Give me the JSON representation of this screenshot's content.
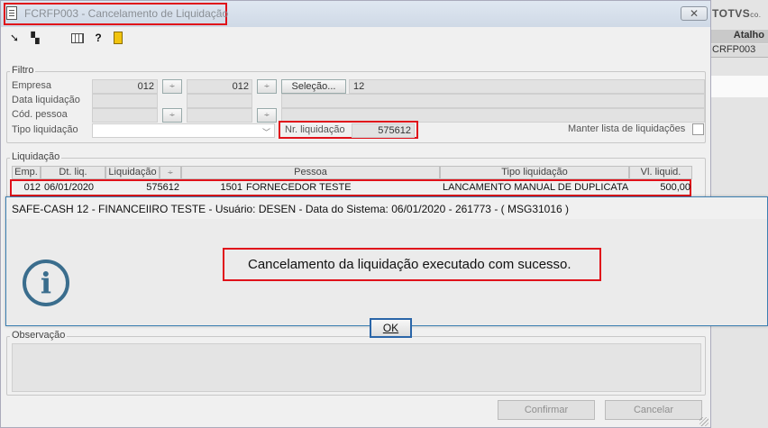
{
  "background": {
    "logo": "TOTVS",
    "logo_suffix": "co.",
    "header": "Atalho",
    "row": "CRFP003"
  },
  "window": {
    "title": "FCRFP003 - Cancelamento de Liquidação"
  },
  "filtro": {
    "title": "Filtro",
    "empresa_label": "Empresa",
    "empresa_from": "012",
    "empresa_to": "012",
    "selecao_label": "Seleção...",
    "selecao_value": "12",
    "data_label": "Data liquidação",
    "pessoa_label": "Cód. pessoa",
    "tipo_label": "Tipo liquidação",
    "nr_label": "Nr. liquidação",
    "nr_value": "575612",
    "manter_label": "Manter lista de liquidações"
  },
  "liquidacao": {
    "title": "Liquidação",
    "columns": [
      "Emp.",
      "Dt. liq.",
      "Liquidação",
      "",
      "Pessoa",
      "Tipo liquidação",
      "Vl. liquid."
    ],
    "row": {
      "emp": "012",
      "dt": "06/01/2020",
      "liq": "575612",
      "cod": "1501",
      "pessoa": "FORNECEDOR TESTE",
      "tipo": "LANCAMENTO MANUAL DE DUPLICATA",
      "valor": "500,00"
    }
  },
  "observacao": {
    "title": "Observação"
  },
  "footer": {
    "confirmar_label": "Confirmar",
    "cancelar_label": "Cancelar"
  },
  "dialog": {
    "title": "SAFE-CASH 12 - FINANCEIIRO TESTE - Usuário: DESEN - Data do Sistema: 06/01/2020 - 261773 - ( MSG31016 )",
    "message": "Cancelamento da liquidação executado com sucesso.",
    "icon": "info-icon",
    "ok_label": "OK"
  }
}
